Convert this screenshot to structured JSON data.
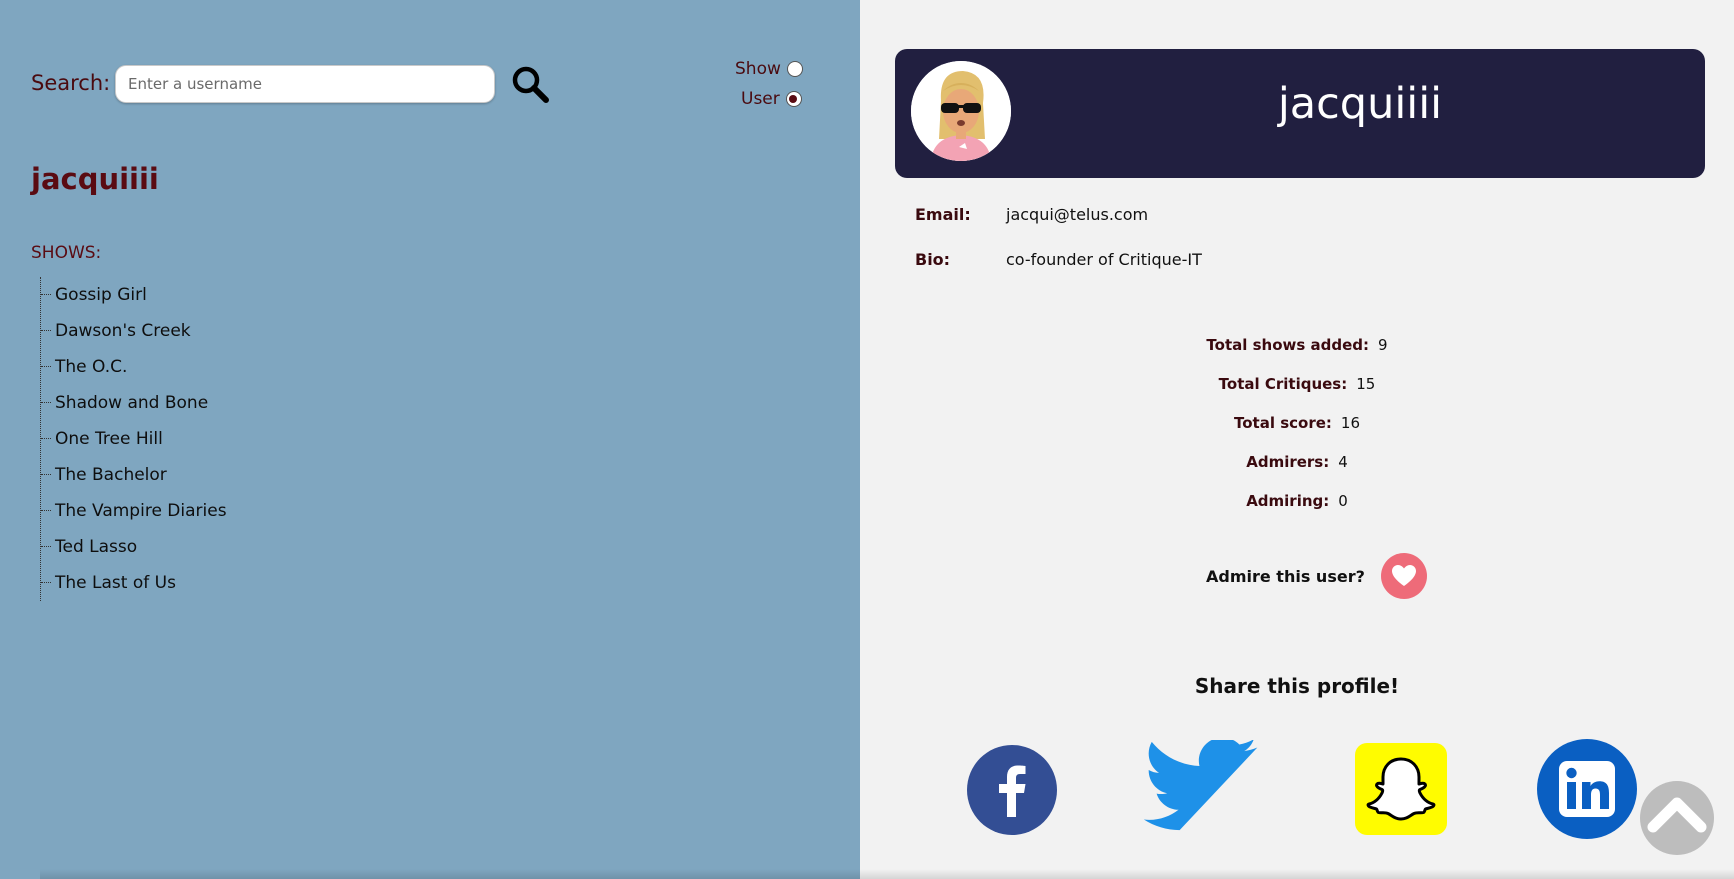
{
  "search": {
    "label": "Search:",
    "placeholder": "Enter a username",
    "value": ""
  },
  "filter": {
    "options": [
      {
        "label": "Show",
        "checked": false
      },
      {
        "label": "User",
        "checked": true
      }
    ]
  },
  "user_summary": {
    "username": "jacquiiii",
    "shows_heading": "SHOWS:",
    "shows": [
      "Gossip Girl",
      "Dawson's Creek",
      "The O.C.",
      "Shadow and Bone",
      "One Tree Hill",
      "The Bachelor",
      "The Vampire Diaries",
      "Ted Lasso",
      "The Last of Us"
    ]
  },
  "profile": {
    "username": "jacquiiii",
    "email_label": "Email:",
    "email": "jacqui@telus.com",
    "bio_label": "Bio:",
    "bio": "co-founder of Critique-IT",
    "stats": [
      {
        "label": "Total shows added:",
        "value": "9"
      },
      {
        "label": "Total Critiques:",
        "value": "15"
      },
      {
        "label": "Total score:",
        "value": "16"
      },
      {
        "label": "Admirers:",
        "value": "4"
      },
      {
        "label": "Admiring:",
        "value": "0"
      }
    ],
    "admire_prompt": "Admire this user?",
    "share_heading": "Share this profile!"
  },
  "social_links": [
    "facebook",
    "twitter",
    "snapchat",
    "linkedin"
  ],
  "colors": {
    "left_panel": "#7fa6c0",
    "header_bg": "#211f40",
    "accent_text": "#5a0b12",
    "heart": "#ee6b79"
  }
}
